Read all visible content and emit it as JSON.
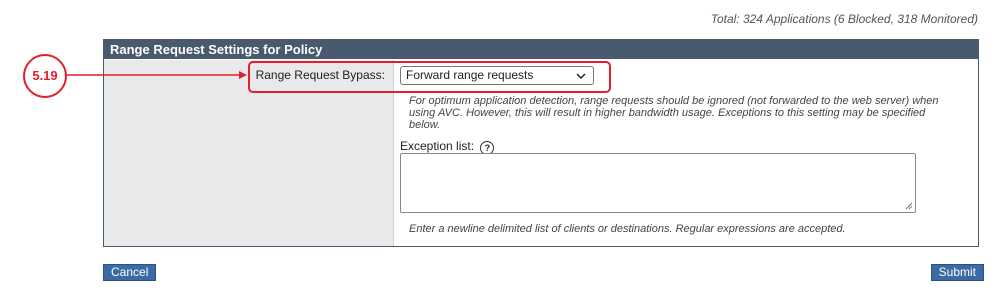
{
  "summary": {
    "total_text": "Total: 324 Applications (6 Blocked, 318 Monitored)"
  },
  "panel": {
    "title": "Range Request Settings for Policy",
    "bypass_label": "Range Request Bypass:",
    "bypass_select": {
      "value": "Forward range requests"
    },
    "help_text": "For optimum application detection, range requests should be ignored (not forwarded to the web server) when using AVC. However, this will result in higher bandwidth usage. Exceptions to this setting may be specified below.",
    "exception_label": "Exception list:",
    "exception_value": "",
    "exception_note": "Enter a newline delimited list of clients or destinations. Regular expressions are accepted."
  },
  "buttons": {
    "cancel": "Cancel",
    "submit": "Submit"
  },
  "callout": {
    "label": "5.19",
    "color": "#e41e2b"
  },
  "colors": {
    "header_bg": "#4a5a6e",
    "button_bg": "#3b6aa5",
    "label_bg": "#e8e9ea"
  },
  "icons": {
    "help": "question-circle-icon",
    "dropdown": "chevron-down-icon"
  }
}
